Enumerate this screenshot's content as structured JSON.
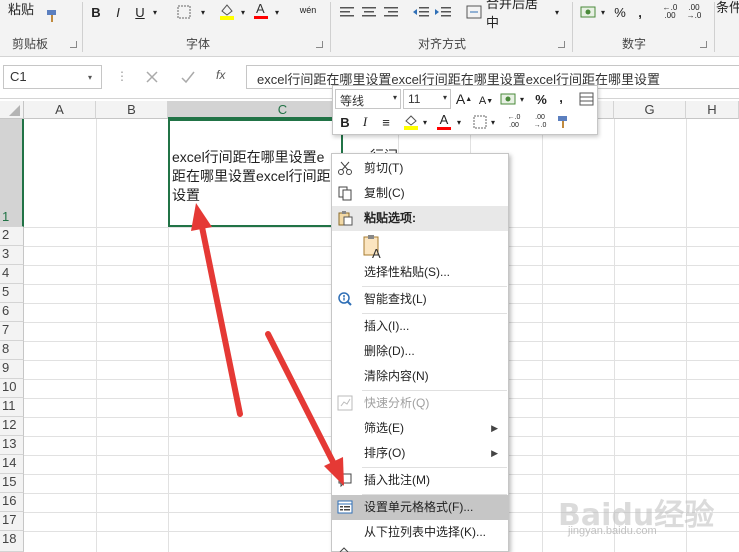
{
  "ribbon": {
    "paste_label": "粘贴",
    "clipboard_group": "剪贴板",
    "font_group": "字体",
    "align_group": "对齐方式",
    "number_group": "数字",
    "merge_center": "合并后居中",
    "bold": "B",
    "italic": "I",
    "underline": "U",
    "phonetic": "wén",
    "percent": "%",
    "comma": ",",
    "cond_format": "条件"
  },
  "formula_bar": {
    "name_box": "C1",
    "fx": "fx",
    "content": "excel行间距在哪里设置excel行间距在哪里设置excel行间距在哪里设置"
  },
  "grid": {
    "columns": [
      "A",
      "B",
      "C",
      "D",
      "E",
      "F",
      "G",
      "H"
    ],
    "rows": [
      "1",
      "2",
      "3",
      "4",
      "5",
      "6",
      "7",
      "8",
      "9",
      "10",
      "11",
      "12",
      "13",
      "14",
      "15",
      "16",
      "17",
      "18"
    ],
    "c1_text_lines": [
      "excel行间距在哪里设置e",
      "距在哪里设置excel行间距",
      "设置"
    ],
    "c1_overflow_text": "行间"
  },
  "mini_toolbar": {
    "font_name": "等线",
    "font_size": "11",
    "grow_font": "A",
    "shrink_font": "A",
    "percent": "%",
    "comma": ",",
    "bold": "B",
    "italic": "I",
    "align_center": "≡",
    "font_color_letter": "A",
    "inc_decimal": "←.0 .00",
    "dec_decimal": ".00 →.0"
  },
  "context_menu": {
    "cut": "剪切(T)",
    "copy": "复制(C)",
    "paste_options": "粘贴选项:",
    "paste_special": "选择性粘贴(S)...",
    "smart_lookup": "智能查找(L)",
    "insert": "插入(I)...",
    "delete": "删除(D)...",
    "clear_contents": "清除内容(N)",
    "quick_analysis": "快速分析(Q)",
    "filter": "筛选(E)",
    "sort": "排序(O)",
    "insert_comment": "插入批注(M)",
    "format_cells": "设置单元格格式(F)...",
    "pick_from_list": "从下拉列表中选择(K)..."
  },
  "watermark": {
    "text": "Baidu经验",
    "sub": "jingyan.baidu.com"
  },
  "colors": {
    "excel_green": "#217346",
    "arrow_red": "#e53935",
    "highlight_yellow": "#ffff00",
    "font_red": "#ff0000"
  }
}
